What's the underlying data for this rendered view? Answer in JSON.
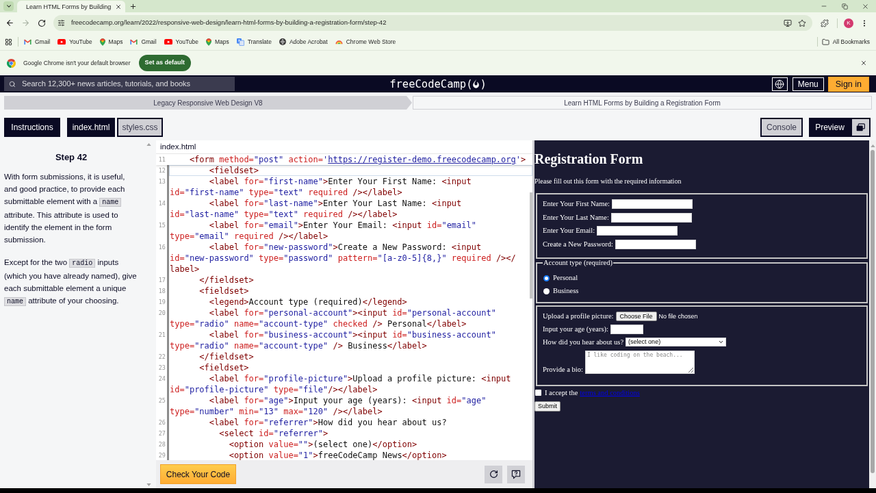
{
  "browser": {
    "tab": {
      "title": "Learn HTML Forms by Building"
    },
    "navigation": {
      "back_disabled": false,
      "forward_disabled": true
    },
    "url": "freecodecamp.org/learn/2022/responsive-web-design/learn-html-forms-by-building-a-registration-form/step-42",
    "profile_initial": "K",
    "bookmarks": [
      {
        "label": "Gmail",
        "kind": "gmail"
      },
      {
        "label": "YouTube",
        "kind": "youtube"
      },
      {
        "label": "Maps",
        "kind": "maps"
      },
      {
        "label": "Gmail",
        "kind": "gmail"
      },
      {
        "label": "YouTube",
        "kind": "youtube"
      },
      {
        "label": "Maps",
        "kind": "maps"
      },
      {
        "label": "Translate",
        "kind": "translate"
      },
      {
        "label": "Adobe Acrobat",
        "kind": "acrobat"
      },
      {
        "label": "Chrome Web Store",
        "kind": "webstore"
      }
    ],
    "all_bookmarks": "All Bookmarks",
    "infobar": {
      "message": "Google Chrome isn't your default browser",
      "button": "Set as default"
    }
  },
  "header": {
    "search": {
      "placeholder": "Search 12,300+ news articles, tutorials, and books"
    },
    "logo": {
      "text": "freeCodeCamp",
      "open": "(",
      "close": ")"
    },
    "menu_button": "Menu",
    "sign_in_button": "Sign in"
  },
  "breadcrumbs": [
    {
      "label": "Legacy Responsive Web Design V8"
    },
    {
      "label": "Learn HTML Forms by Building a Registration Form"
    }
  ],
  "left_tabs": [
    {
      "label": "Instructions",
      "selected": true
    },
    {
      "label": "index.html",
      "selected": true
    },
    {
      "label": "styles.css",
      "selected": false
    }
  ],
  "right_tabs": [
    {
      "label": "Console",
      "selected": false
    },
    {
      "label": "Preview",
      "selected": true
    }
  ],
  "instructions": {
    "title": "Step 42",
    "paragraphs": [
      [
        {
          "kind": "text",
          "text": "With form submissions, it is useful, and good practice, to provide each submittable element with a "
        },
        {
          "kind": "code",
          "text": "name"
        },
        {
          "kind": "text",
          "text": " attribute. This attribute is used to identify the element in the form submission."
        }
      ],
      [
        {
          "kind": "text",
          "text": "Except for the two "
        },
        {
          "kind": "code",
          "text": "radio"
        },
        {
          "kind": "text",
          "text": " inputs (which you have already named), give each submittable element a unique "
        },
        {
          "kind": "code",
          "text": "name"
        },
        {
          "kind": "text",
          "text": " attribute of your choosing."
        }
      ]
    ]
  },
  "editor": {
    "file": "index.html",
    "sticky_line": {
      "number": "11",
      "rows": [
        {
          "segments": [
            {
              "kind": "tag",
              "text": "    <form"
            },
            {
              "kind": "attr",
              "text": " method="
            },
            {
              "kind": "value",
              "text": "\"post\""
            },
            {
              "kind": "attr",
              "text": " action="
            },
            {
              "kind": "value",
              "text": "'"
            },
            {
              "kind": "link",
              "text": "https://register-demo.freecodecamp.org"
            },
            {
              "kind": "value",
              "text": "'"
            },
            {
              "kind": "tag",
              "text": ">"
            }
          ]
        }
      ]
    },
    "lines": [
      {
        "number": "12",
        "current": true,
        "rows": [
          {
            "segments": [
              {
                "kind": "tag",
                "text": "        <fieldset>"
              }
            ]
          }
        ]
      },
      {
        "number": "13",
        "current": false,
        "rows": [
          {
            "segments": [
              {
                "kind": "tag",
                "text": "        <label"
              },
              {
                "kind": "attr",
                "text": " for="
              },
              {
                "kind": "value",
                "text": "\"first-name\""
              },
              {
                "kind": "tag",
                "text": ">"
              },
              {
                "kind": "text",
                "text": "Enter Your First Name: "
              },
              {
                "kind": "tag",
                "text": "<input"
              }
            ]
          },
          {
            "segments": [
              {
                "kind": "attr",
                "text": "id="
              },
              {
                "kind": "value",
                "text": "\"first-name\""
              },
              {
                "kind": "attr",
                "text": " type="
              },
              {
                "kind": "value",
                "text": "\"text\""
              },
              {
                "kind": "attr",
                "text": " required"
              },
              {
                "kind": "tag",
                "text": " /></label>"
              }
            ]
          }
        ]
      },
      {
        "number": "14",
        "current": false,
        "rows": [
          {
            "segments": [
              {
                "kind": "tag",
                "text": "        <label"
              },
              {
                "kind": "attr",
                "text": " for="
              },
              {
                "kind": "value",
                "text": "\"last-name\""
              },
              {
                "kind": "tag",
                "text": ">"
              },
              {
                "kind": "text",
                "text": "Enter Your Last Name: "
              },
              {
                "kind": "tag",
                "text": "<input"
              }
            ]
          },
          {
            "segments": [
              {
                "kind": "attr",
                "text": "id="
              },
              {
                "kind": "value",
                "text": "\"last-name\""
              },
              {
                "kind": "attr",
                "text": " type="
              },
              {
                "kind": "value",
                "text": "\"text\""
              },
              {
                "kind": "attr",
                "text": " required"
              },
              {
                "kind": "tag",
                "text": " /></label>"
              }
            ]
          }
        ]
      },
      {
        "number": "15",
        "current": false,
        "rows": [
          {
            "segments": [
              {
                "kind": "tag",
                "text": "        <label"
              },
              {
                "kind": "attr",
                "text": " for="
              },
              {
                "kind": "value",
                "text": "\"email\""
              },
              {
                "kind": "tag",
                "text": ">"
              },
              {
                "kind": "text",
                "text": "Enter Your Email: "
              },
              {
                "kind": "tag",
                "text": "<input"
              },
              {
                "kind": "attr",
                "text": " id="
              },
              {
                "kind": "value",
                "text": "\"email\""
              }
            ]
          },
          {
            "segments": [
              {
                "kind": "attr",
                "text": "type="
              },
              {
                "kind": "value",
                "text": "\"email\""
              },
              {
                "kind": "attr",
                "text": " required"
              },
              {
                "kind": "tag",
                "text": " /></label>"
              }
            ]
          }
        ]
      },
      {
        "number": "16",
        "current": false,
        "rows": [
          {
            "segments": [
              {
                "kind": "tag",
                "text": "        <label"
              },
              {
                "kind": "attr",
                "text": " for="
              },
              {
                "kind": "value",
                "text": "\"new-password\""
              },
              {
                "kind": "tag",
                "text": ">"
              },
              {
                "kind": "text",
                "text": "Create a New Password: "
              },
              {
                "kind": "tag",
                "text": "<input"
              }
            ]
          },
          {
            "segments": [
              {
                "kind": "attr",
                "text": "id="
              },
              {
                "kind": "value",
                "text": "\"new-password\""
              },
              {
                "kind": "attr",
                "text": " type="
              },
              {
                "kind": "value",
                "text": "\"password\""
              },
              {
                "kind": "attr",
                "text": " pattern="
              },
              {
                "kind": "value",
                "text": "\"[a-z0-5]{8,}\""
              },
              {
                "kind": "attr",
                "text": " required"
              },
              {
                "kind": "tag",
                "text": " /></"
              }
            ]
          },
          {
            "segments": [
              {
                "kind": "tag",
                "text": "label>"
              }
            ]
          }
        ]
      },
      {
        "number": "17",
        "current": false,
        "rows": [
          {
            "segments": [
              {
                "kind": "tag",
                "text": "      </fieldset>"
              }
            ]
          }
        ]
      },
      {
        "number": "18",
        "current": false,
        "rows": [
          {
            "segments": [
              {
                "kind": "tag",
                "text": "      <fieldset>"
              }
            ]
          }
        ]
      },
      {
        "number": "19",
        "current": false,
        "rows": [
          {
            "segments": [
              {
                "kind": "tag",
                "text": "        <legend>"
              },
              {
                "kind": "text",
                "text": "Account type (required)"
              },
              {
                "kind": "tag",
                "text": "</legend>"
              }
            ]
          }
        ]
      },
      {
        "number": "20",
        "current": false,
        "rows": [
          {
            "segments": [
              {
                "kind": "tag",
                "text": "        <label"
              },
              {
                "kind": "attr",
                "text": " for="
              },
              {
                "kind": "value",
                "text": "\"personal-account\""
              },
              {
                "kind": "tag",
                "text": "><input"
              },
              {
                "kind": "attr",
                "text": " id="
              },
              {
                "kind": "value",
                "text": "\"personal-account\""
              }
            ]
          },
          {
            "segments": [
              {
                "kind": "attr",
                "text": "type="
              },
              {
                "kind": "value",
                "text": "\"radio\""
              },
              {
                "kind": "attr",
                "text": " name="
              },
              {
                "kind": "value",
                "text": "\"account-type\""
              },
              {
                "kind": "attr",
                "text": " checked"
              },
              {
                "kind": "tag",
                "text": " />"
              },
              {
                "kind": "text",
                "text": " Personal"
              },
              {
                "kind": "tag",
                "text": "</label>"
              }
            ]
          }
        ]
      },
      {
        "number": "21",
        "current": false,
        "rows": [
          {
            "segments": [
              {
                "kind": "tag",
                "text": "        <label"
              },
              {
                "kind": "attr",
                "text": " for="
              },
              {
                "kind": "value",
                "text": "\"business-account\""
              },
              {
                "kind": "tag",
                "text": "><input"
              },
              {
                "kind": "attr",
                "text": " id="
              },
              {
                "kind": "value",
                "text": "\"business-account\""
              }
            ]
          },
          {
            "segments": [
              {
                "kind": "attr",
                "text": "type="
              },
              {
                "kind": "value",
                "text": "\"radio\""
              },
              {
                "kind": "attr",
                "text": " name="
              },
              {
                "kind": "value",
                "text": "\"account-type\""
              },
              {
                "kind": "tag",
                "text": " />"
              },
              {
                "kind": "text",
                "text": " Business"
              },
              {
                "kind": "tag",
                "text": "</label>"
              }
            ]
          }
        ]
      },
      {
        "number": "22",
        "current": false,
        "rows": [
          {
            "segments": [
              {
                "kind": "tag",
                "text": "      </fieldset>"
              }
            ]
          }
        ]
      },
      {
        "number": "23",
        "current": false,
        "rows": [
          {
            "segments": [
              {
                "kind": "tag",
                "text": "      <fieldset>"
              }
            ]
          }
        ]
      },
      {
        "number": "24",
        "current": false,
        "rows": [
          {
            "segments": [
              {
                "kind": "tag",
                "text": "        <label"
              },
              {
                "kind": "attr",
                "text": " for="
              },
              {
                "kind": "value",
                "text": "\"profile-picture\""
              },
              {
                "kind": "tag",
                "text": ">"
              },
              {
                "kind": "text",
                "text": "Upload a profile picture: "
              },
              {
                "kind": "tag",
                "text": "<input"
              }
            ]
          },
          {
            "segments": [
              {
                "kind": "attr",
                "text": "id="
              },
              {
                "kind": "value",
                "text": "\"profile-picture\""
              },
              {
                "kind": "attr",
                "text": " type="
              },
              {
                "kind": "value",
                "text": "\"file\""
              },
              {
                "kind": "tag",
                "text": "/></label>"
              }
            ]
          }
        ]
      },
      {
        "number": "25",
        "current": false,
        "rows": [
          {
            "segments": [
              {
                "kind": "tag",
                "text": "        <label"
              },
              {
                "kind": "attr",
                "text": " for="
              },
              {
                "kind": "value",
                "text": "\"age\""
              },
              {
                "kind": "tag",
                "text": ">"
              },
              {
                "kind": "text",
                "text": "Input your age (years): "
              },
              {
                "kind": "tag",
                "text": "<input"
              },
              {
                "kind": "attr",
                "text": " id="
              },
              {
                "kind": "value",
                "text": "\"age\""
              }
            ]
          },
          {
            "segments": [
              {
                "kind": "attr",
                "text": "type="
              },
              {
                "kind": "value",
                "text": "\"number\""
              },
              {
                "kind": "attr",
                "text": " min="
              },
              {
                "kind": "value",
                "text": "\"13\""
              },
              {
                "kind": "attr",
                "text": " max="
              },
              {
                "kind": "value",
                "text": "\"120\""
              },
              {
                "kind": "tag",
                "text": " /></label>"
              }
            ]
          }
        ]
      },
      {
        "number": "26",
        "current": false,
        "rows": [
          {
            "segments": [
              {
                "kind": "tag",
                "text": "        <label"
              },
              {
                "kind": "attr",
                "text": " for="
              },
              {
                "kind": "value",
                "text": "\"referrer\""
              },
              {
                "kind": "tag",
                "text": ">"
              },
              {
                "kind": "text",
                "text": "How did you hear about us?"
              }
            ]
          }
        ]
      },
      {
        "number": "27",
        "current": false,
        "rows": [
          {
            "segments": [
              {
                "kind": "tag",
                "text": "          <select"
              },
              {
                "kind": "attr",
                "text": " id="
              },
              {
                "kind": "value",
                "text": "\"referrer\""
              },
              {
                "kind": "tag",
                "text": ">"
              }
            ]
          }
        ]
      },
      {
        "number": "28",
        "current": false,
        "rows": [
          {
            "segments": [
              {
                "kind": "tag",
                "text": "            <option"
              },
              {
                "kind": "attr",
                "text": " value="
              },
              {
                "kind": "value",
                "text": "\"\""
              },
              {
                "kind": "tag",
                "text": ">"
              },
              {
                "kind": "text",
                "text": "(select one)"
              },
              {
                "kind": "tag",
                "text": "</option>"
              }
            ]
          }
        ]
      },
      {
        "number": "29",
        "current": false,
        "rows": [
          {
            "segments": [
              {
                "kind": "tag",
                "text": "            <option"
              },
              {
                "kind": "attr",
                "text": " value="
              },
              {
                "kind": "value",
                "text": "\"1\""
              },
              {
                "kind": "tag",
                "text": ">"
              },
              {
                "kind": "text",
                "text": "freeCodeCamp News"
              },
              {
                "kind": "tag",
                "text": "</option>"
              }
            ]
          }
        ]
      }
    ],
    "check_button": "Check Your Code"
  },
  "preview": {
    "title": "Registration Form",
    "subtitle": "Please fill out this form with the required information",
    "fieldsets": [
      {
        "fields": [
          {
            "kind": "text",
            "label": "Enter Your First Name:"
          },
          {
            "kind": "text",
            "label": "Enter Your Last Name:"
          },
          {
            "kind": "text",
            "label": "Enter Your Email:"
          },
          {
            "kind": "text",
            "label": "Create a New Password:"
          }
        ]
      },
      {
        "legend": "Account type (required)",
        "fields": [
          {
            "kind": "radio",
            "label": "Personal",
            "checked": true
          },
          {
            "kind": "radio",
            "label": "Business",
            "checked": false
          }
        ]
      },
      {
        "fields": [
          {
            "kind": "file",
            "label": "Upload a profile picture:",
            "button": "Choose File",
            "status": "No file chosen"
          },
          {
            "kind": "number",
            "label": "Input your age (years):"
          },
          {
            "kind": "select",
            "label": "How did you hear about us?",
            "value": "(select one)"
          },
          {
            "kind": "textarea",
            "label": "Provide a bio:",
            "placeholder": "I like coding on the beach..."
          }
        ]
      }
    ],
    "terms": {
      "checked": false,
      "text": "I accept the",
      "link": "terms and conditions"
    },
    "submit": "Submit"
  }
}
